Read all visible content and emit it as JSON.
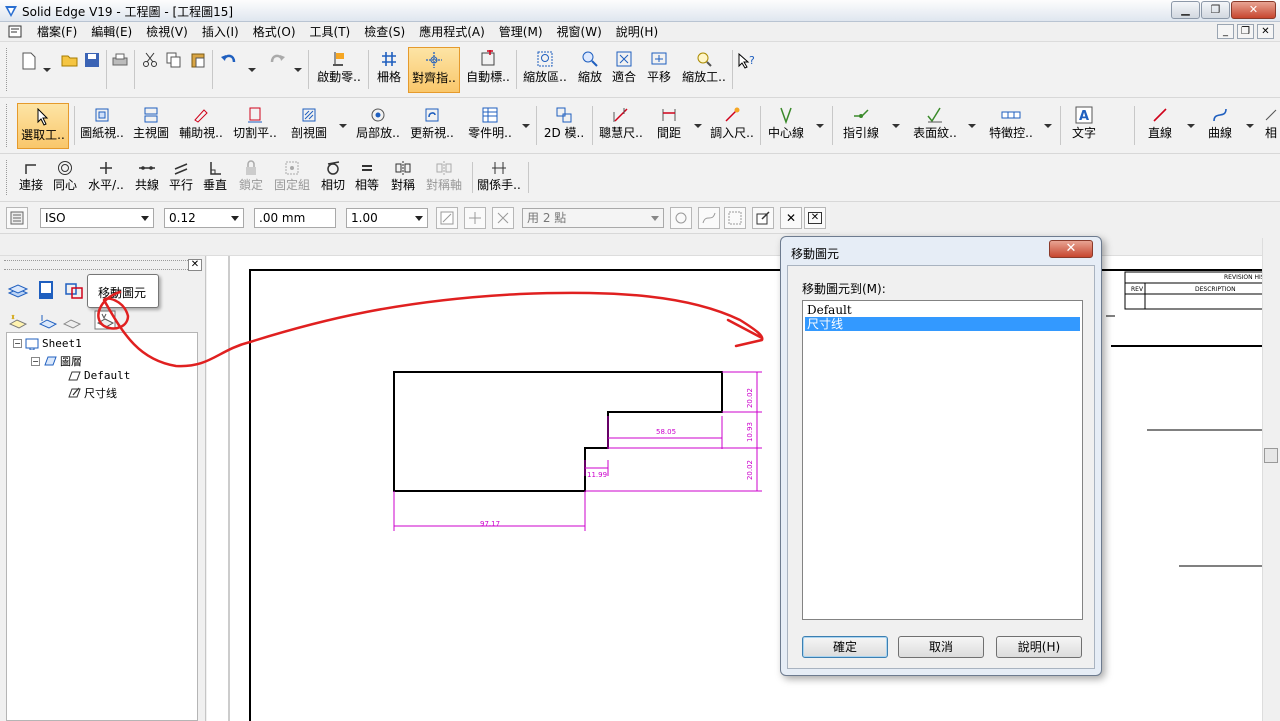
{
  "window": {
    "title": "Solid Edge V19 - 工程圖 - [工程圖15]"
  },
  "menu": [
    "檔案(F)",
    "編輯(E)",
    "檢視(V)",
    "插入(I)",
    "格式(O)",
    "工具(T)",
    "檢查(S)",
    "應用程式(A)",
    "管理(M)",
    "視窗(W)",
    "說明(H)"
  ],
  "toolbar1": {
    "items": [
      "啟動零..",
      "柵格",
      "對齊指..",
      "自動標..",
      "縮放區..",
      "縮放",
      "適合",
      "平移",
      "縮放工.."
    ]
  },
  "toolbar2": {
    "items": [
      "選取工..",
      "圖紙視..",
      "主視圖",
      "輔助視..",
      "切割平..",
      "剖視圖",
      "局部放..",
      "更新視..",
      "零件明..",
      "2D 模..",
      "聰慧尺..",
      "間距",
      "調入尺..",
      "中心線",
      "指引線",
      "表面紋..",
      "特徵控..",
      "文字",
      "直線",
      "曲線",
      "相"
    ]
  },
  "toolbar3": {
    "items": [
      "連接",
      "同心",
      "水平/..",
      "共線",
      "平行",
      "垂直",
      "鎖定",
      "固定組",
      "相切",
      "相等",
      "對稱",
      "對稱軸",
      "關係手.."
    ]
  },
  "ribbon4": {
    "standard": "ISO",
    "line_width": "0.12",
    "offset": ".00 mm",
    "scale": "1.00",
    "mode": "用 2 點"
  },
  "left_panel": {
    "tooltip": "移動圖元",
    "tree": {
      "sheet": "Sheet1",
      "layers": "圖層",
      "layer_default": "Default",
      "layer_dim": "尺寸线"
    }
  },
  "drawing": {
    "dimensions": [
      "20.02",
      "10.93",
      "20.02",
      "58.05",
      "11.99",
      "97.17"
    ],
    "title_block": {
      "revision": "REVISION HIS",
      "rev": "REV",
      "description": "DESCRIPTION"
    }
  },
  "dialog": {
    "title": "移動圖元",
    "label": "移動圖元到(M):",
    "items": [
      "Default",
      "尺寸线"
    ],
    "selected": "尺寸线",
    "ok": "確定",
    "cancel": "取消",
    "help": "說明(H)"
  },
  "colors": {
    "dimension": "#cc00cc",
    "annotation": "#e02020",
    "selection": "#3399ff",
    "active_tool": "#f9c76b"
  }
}
